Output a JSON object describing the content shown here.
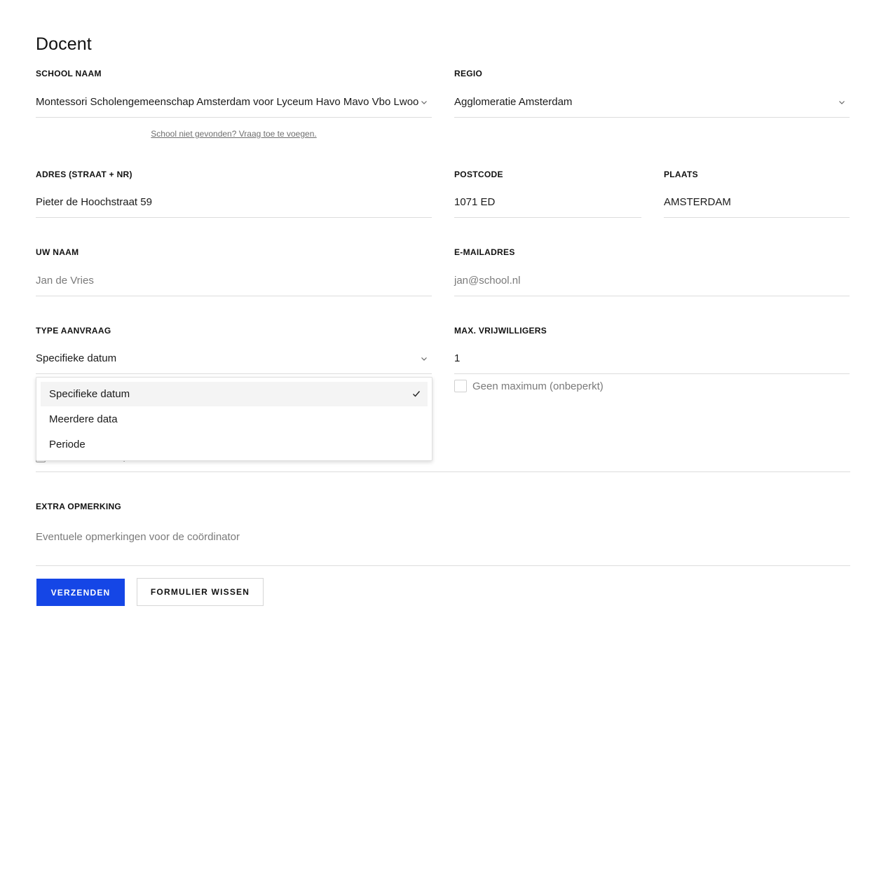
{
  "page": {
    "title": "Docent"
  },
  "school": {
    "label": "SCHOOL NAAM",
    "value": "Montessori Scholengemeenschap Amsterdam voor Lyceum Havo Mavo Vbo Lwoo",
    "help_link": "School niet gevonden? Vraag toe te voegen."
  },
  "regio": {
    "label": "REGIO",
    "value": "Agglomeratie Amsterdam"
  },
  "adres": {
    "label": "ADRES (STRAAT + NR)",
    "value": "Pieter de Hoochstraat 59"
  },
  "postcode": {
    "label": "POSTCODE",
    "value": "1071 ED"
  },
  "plaats": {
    "label": "PLAATS",
    "value": "AMSTERDAM"
  },
  "naam": {
    "label": "UW NAAM",
    "placeholder": "Jan de Vries"
  },
  "email": {
    "label": "E-MAILADRES",
    "placeholder": "jan@school.nl"
  },
  "type_aanvraag": {
    "label": "TYPE AANVRAAG",
    "value": "Specifieke datum",
    "options": [
      "Specifieke datum",
      "Meerdere data",
      "Periode"
    ],
    "selected_index": 0
  },
  "max_vrijwilligers": {
    "label": "MAX. VRIJWILLIGERS",
    "value": "1",
    "unlimited_label": "Geen maximum (onbeperkt)",
    "unlimited_checked": false
  },
  "opmerking": {
    "label": "EXTRA OPMERKING",
    "placeholder": "Eventuele opmerkingen voor de coördinator"
  },
  "actions": {
    "submit": "VERZENDEN",
    "reset": "FORMULIER WISSEN"
  },
  "colors": {
    "primary": "#1546e6",
    "border": "#dcdcdc",
    "placeholder": "#7a7a7a"
  },
  "icons": {
    "select_arrow": "chevron-down-icon",
    "selected_option": "check-icon"
  }
}
